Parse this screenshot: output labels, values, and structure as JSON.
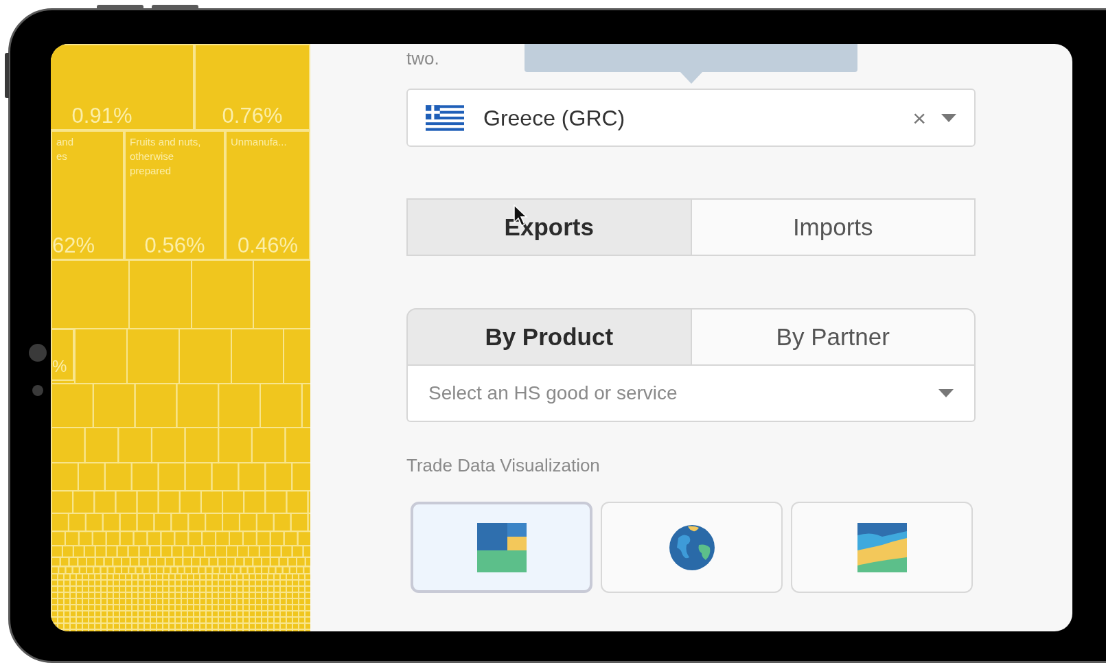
{
  "treemap": {
    "tiles": [
      {
        "value": "0.91%"
      },
      {
        "value": "0.76%"
      },
      {
        "label_lines": [
          "and",
          "es"
        ],
        "value": "62%"
      },
      {
        "label_lines": [
          "Fruits and nuts,",
          "otherwise",
          "prepared"
        ],
        "value": "0.56%"
      },
      {
        "label_lines": [
          "Unmanufa..."
        ],
        "value": "0.46%"
      },
      {
        "value": "%"
      }
    ]
  },
  "intro_text": "two.",
  "country_select": {
    "value": "Greece (GRC)",
    "clear": "×"
  },
  "flow_tabs": [
    {
      "label": "Exports",
      "selected": true
    },
    {
      "label": "Imports",
      "selected": false
    }
  ],
  "group_tabs": [
    {
      "label": "By Product",
      "selected": true
    },
    {
      "label": "By Partner",
      "selected": false
    }
  ],
  "product_select": {
    "placeholder": "Select an HS good or service"
  },
  "section_label": "Trade Data Visualization",
  "viz_options": [
    {
      "kind": "treemap",
      "selected": true
    },
    {
      "kind": "globe",
      "selected": false
    },
    {
      "kind": "stacked-area",
      "selected": false
    }
  ]
}
